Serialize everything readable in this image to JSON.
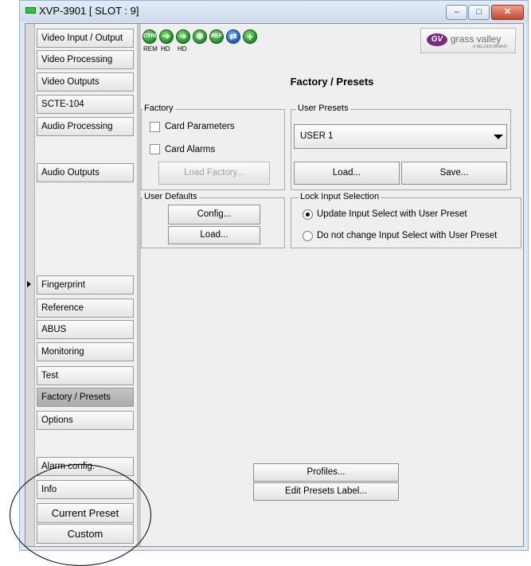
{
  "window": {
    "title": "XVP-3901 [ SLOT : 9]",
    "controls": {
      "minimize": "–",
      "maximize": "□",
      "close": "✕"
    }
  },
  "toolbar": {
    "icons": [
      {
        "name": "ctrl-icon",
        "text": "CTRL",
        "label": "REM"
      },
      {
        "name": "hd-arrow-icon-1",
        "text": "➔",
        "label": "HD"
      },
      {
        "name": "hd-arrow-icon-2",
        "text": "➔",
        "label": "HD"
      },
      {
        "name": "audio-icon",
        "text": "◉",
        "label": ""
      },
      {
        "name": "ref-icon",
        "text": "REF",
        "label": ""
      },
      {
        "name": "sync-arrow-icon",
        "text": "⇄",
        "label": ""
      },
      {
        "name": "plus-icon",
        "text": "+",
        "label": ""
      }
    ],
    "logo": {
      "text": "grass valley",
      "subtext": "A BELDEN BRAND",
      "mark": "GV"
    }
  },
  "sidebar": {
    "items": [
      {
        "label": "Video Input / Output"
      },
      {
        "label": "Video Processing"
      },
      {
        "label": "Video Outputs"
      },
      {
        "label": "SCTE-104"
      },
      {
        "label": "Audio Processing"
      },
      {
        "label": "Audio Outputs"
      },
      {
        "label": "Fingerprint"
      },
      {
        "label": "Reference"
      },
      {
        "label": "ABUS"
      },
      {
        "label": "Monitoring"
      },
      {
        "label": "Test"
      },
      {
        "label": "Factory / Presets",
        "active": true
      },
      {
        "label": "Options"
      },
      {
        "label": "Alarm config."
      },
      {
        "label": "Info"
      }
    ],
    "current_preset_label": "Current Preset",
    "current_preset_value": "Custom"
  },
  "main": {
    "title": "Factory / Presets",
    "factory": {
      "title": "Factory",
      "card_parameters": "Card Parameters",
      "card_alarms": "Card Alarms",
      "load_factory": "Load Factory..."
    },
    "user_presets": {
      "title": "User Presets",
      "selected": "USER 1",
      "load": "Load...",
      "save": "Save..."
    },
    "user_defaults": {
      "title": "User Defaults",
      "config": "Config...",
      "load": "Load..."
    },
    "lock_input": {
      "title": "Lock Input Selection",
      "option_update": "Update Input Select with User Preset",
      "option_no_change": "Do not change Input Select with User Preset"
    },
    "profiles": "Profiles...",
    "edit_presets_label": "Edit Presets Label..."
  }
}
